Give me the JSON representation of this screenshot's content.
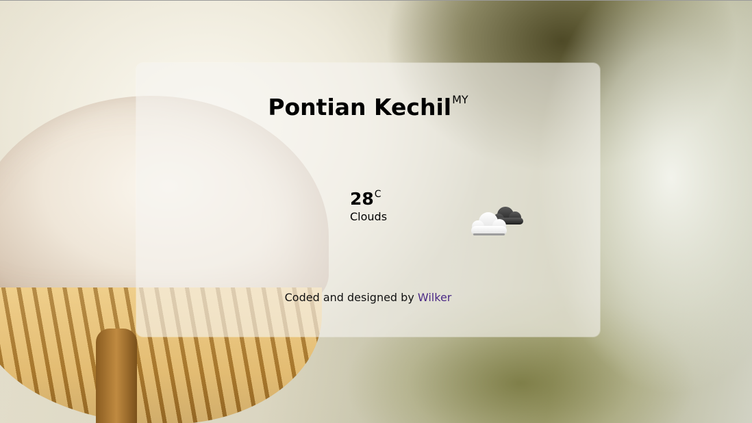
{
  "location": {
    "city": "Pontian Kechil",
    "country_code": "MY"
  },
  "weather": {
    "temperature": "28",
    "unit": "C",
    "description": "Clouds",
    "icon": "broken-clouds-icon"
  },
  "footer": {
    "prefix": "Coded and designed by",
    "author_link": "Wilker"
  },
  "colors": {
    "link": "#4b2a86",
    "card_background": "rgba(245,244,240,0.62)"
  }
}
